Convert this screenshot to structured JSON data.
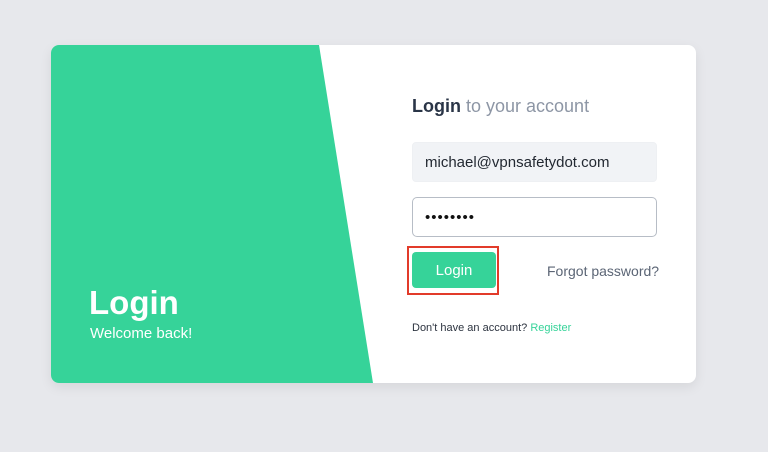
{
  "colors": {
    "background": "#e7e8ec",
    "accent": "#36d399",
    "card": "#ffffff",
    "highlight_outline": "#e23b2a"
  },
  "hero": {
    "title": "Login",
    "subtitle": "Welcome back!"
  },
  "form": {
    "heading_strong": "Login",
    "heading_rest": "to your account",
    "email_value": "michael@vpnsafetydot.com",
    "password_value": "••••••••",
    "login_button": "Login",
    "forgot_password": "Forgot password?",
    "signup_prompt": "Don't have an account?",
    "register_link": "Register"
  }
}
